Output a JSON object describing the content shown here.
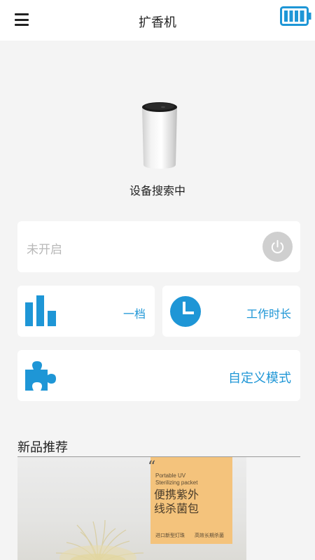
{
  "header": {
    "title": "扩香机",
    "menu_icon": "menu-icon",
    "battery_icon": "battery-full-icon",
    "accent_color": "#1e96d6"
  },
  "device": {
    "status": "设备搜索中"
  },
  "power": {
    "state_label": "未开启",
    "button_icon": "power-icon"
  },
  "level": {
    "label": "一档",
    "icon": "bar-chart-icon"
  },
  "timer": {
    "label": "工作时长",
    "icon": "clock-icon"
  },
  "custom": {
    "label": "自定义模式",
    "icon": "puzzle-icon"
  },
  "section": {
    "title": "新品推荐"
  },
  "banner": {
    "quote_mark": "“",
    "en_line1": "Portable UV",
    "en_line2": "Sterilizing packet",
    "cn_line1": "便携紫外",
    "cn_line2": "线杀菌包",
    "feature1": "进口新型灯珠",
    "feature2": "高效长期杀菌"
  }
}
